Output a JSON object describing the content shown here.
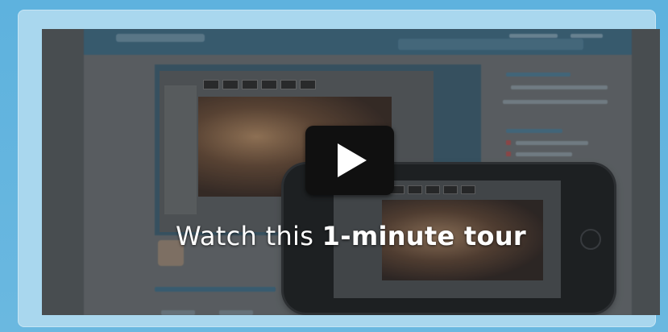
{
  "video": {
    "caption_prefix": "Watch this ",
    "caption_emphasis": "1-minute tour",
    "play_icon": "play-icon"
  },
  "colors": {
    "background": "#5fb3dc",
    "card": "#a9d7ee",
    "play_button": "#101010"
  }
}
